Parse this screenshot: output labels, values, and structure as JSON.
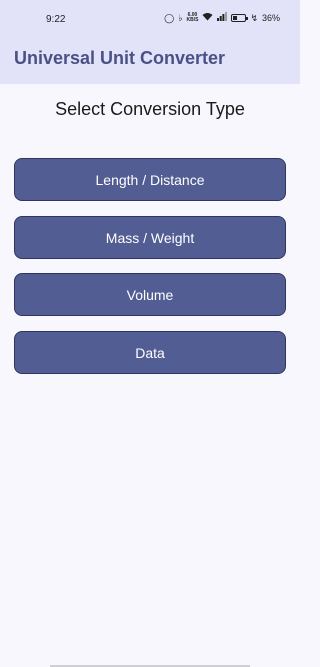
{
  "status_bar": {
    "time": "9:22",
    "net_speed_value": "6.00",
    "net_speed_unit": "KB/S",
    "battery": "36%"
  },
  "app_bar": {
    "title": "Universal Unit Converter"
  },
  "main": {
    "heading": "Select Conversion Type",
    "buttons": [
      {
        "label": "Length / Distance"
      },
      {
        "label": "Mass / Weight"
      },
      {
        "label": "Volume"
      },
      {
        "label": "Data"
      }
    ]
  },
  "colors": {
    "app_bar_bg": "#e2e3f8",
    "title_color": "#4a5187",
    "button_bg": "#525d93",
    "page_bg": "#f8f7fd"
  }
}
